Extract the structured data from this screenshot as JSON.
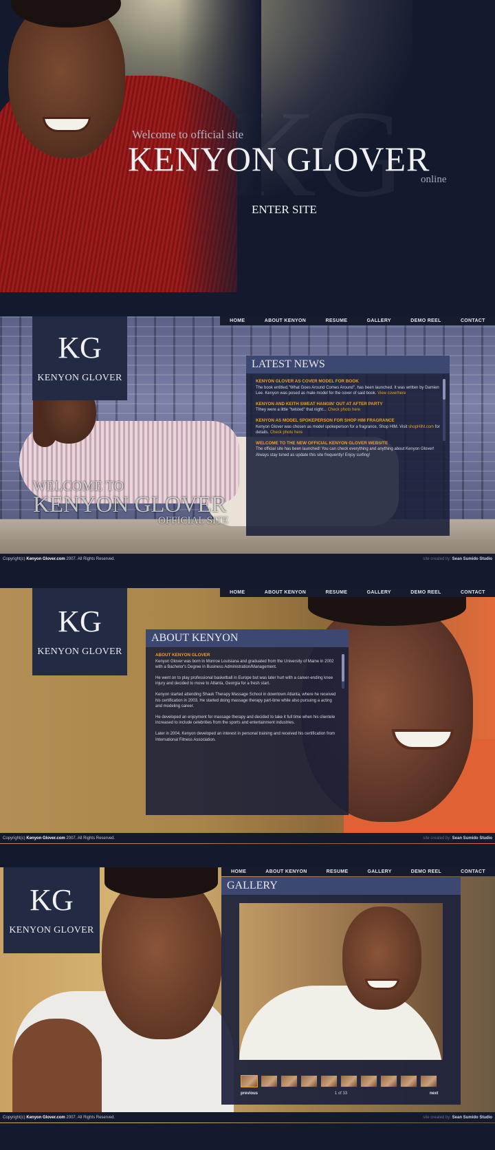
{
  "splash": {
    "welcome": "Welcome to official site",
    "name": "KENYON GLOVER",
    "online": "online",
    "enter": "ENTER SITE"
  },
  "nav": [
    "HOME",
    "ABOUT KENYON",
    "RESUME",
    "GALLERY",
    "DEMO REEL",
    "CONTACT"
  ],
  "logo": {
    "mark": "KG",
    "name": "KENYON GLOVER"
  },
  "footer": {
    "copyright_prefix": "Copyright(c)",
    "site": "Kenyon Glover.com",
    "copyright_suffix": "2007. All Rights Reserved.",
    "credit_prefix": "site created by",
    "studio": "Sean Sumido Studio"
  },
  "home": {
    "welcome_l1": "WELCOME TO",
    "welcome_l2": "KENYON GLOVER",
    "welcome_l3": "OFFICIAL SITE",
    "news_title": "LATEST NEWS",
    "news": [
      {
        "title": "KENYON GLOVER AS COVER MODEL FOR BOOK",
        "body": "The book entitled,\"What Goes Around Comes Around\", has been launched. It was written by Damien Lee. Kenyon was posed as male model for the cover of said book.",
        "link": "View coverhere"
      },
      {
        "title": "KENYON AND KEITH SWEAT HANGIN' OUT AT AFTER PARTY",
        "body": "TIhey were a little \"twisted\" that night...",
        "link": "Check photo here"
      },
      {
        "title": "KENYON AS MODEL SPOKEPERSON FOR SHOP HIM FRAGRANCE",
        "body": "Kenyon Glover was chosen as model spokeperson for a fragrance, Shop HIM. Visit",
        "link_inline": "shopHIM.com",
        "body2": "for details.",
        "link": "Check photo here"
      },
      {
        "title": "WELCOME TO THE NEW OFFICIAL KENYON GLOVER WEBSITE",
        "body": "The official site has been launched! You can check everything and anything about Kenyon Glover! Always stay tuned as update this site frequently! Enjoy surfing!"
      }
    ]
  },
  "about": {
    "title": "ABOUT KENYON",
    "subhead": "ABOUT KENYON GLOVER",
    "paragraphs": [
      "Kenyon Glover was born in Monroe Louisiana and graduated from the University of Maine in 2002 with a Bachelor's Degree in Business Administration/Management.",
      "He went on to play professional basketball in Europe but was later hurt with a career-ending knee injury and decided to move to Atlanta, Georgia for a fresh start.",
      "Kenyon started attending Shauk Therapy Massage School in downtown Atlanta, where he received his certification in 2003. He started doing massage therapy part-time while also pursuing a acting and modeling career.",
      "He developed an enjoyment for massage therapy and decided to take it full time when his clientele increased to include celebrities from the sports and entertainment industries.",
      "Later in 2004, Kenyon developed an interest in personal training and received his certification from International Fitness Association."
    ]
  },
  "gallery": {
    "title": "GALLERY",
    "previous": "previous",
    "next": "next",
    "counter": "1 of 33",
    "thumb_count_visible": 10
  },
  "colors": {
    "navy": "#141a2e",
    "box_header": "#3d4872",
    "accent": "#f0a11c"
  }
}
